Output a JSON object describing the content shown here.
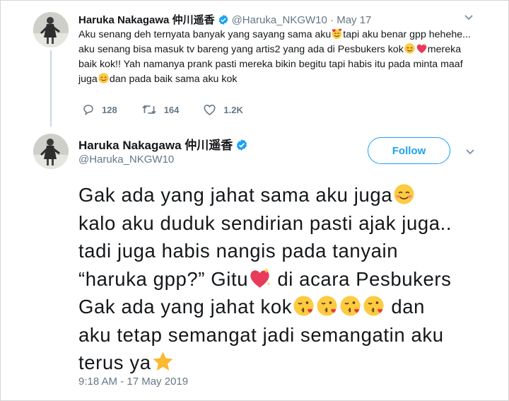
{
  "colors": {
    "accent": "#1da1f2",
    "muted": "#657786",
    "text": "#14171a"
  },
  "reply_tweet": {
    "author_name": "Haruka Nakagawa 仲川遥香",
    "handle": "@Haruka_NKGW10",
    "date_sep": " · ",
    "date": "May 17",
    "text_parts": [
      "Aku senang deh ternyata banyak yang sayang sama aku",
      "tapi aku benar gpp hehehe... aku senang bisa masuk tv bareng yang artis2 yang ada di Pesbukers kok",
      "mereka baik kok!! Yah namanya prank pasti mereka bikin begitu tapi habis itu pada minta maaf juga",
      "dan pada baik sama aku kok"
    ],
    "reply_count": "128",
    "retweet_count": "164",
    "like_count": "1.2K",
    "icons": [
      "smiling-face-with-hearts-icon",
      "relieved-face-icon",
      "sparkling-heart-icon",
      "smiling-blush-face-icon"
    ]
  },
  "main_tweet": {
    "author_name": "Haruka Nakagawa 仲川遥香",
    "handle": "@Haruka_NKGW10",
    "follow_label": "Follow",
    "lines": {
      "l1": "Gak ada yang jahat sama aku juga",
      "l2": "kalo aku duduk sendirian pasti ajak juga..",
      "l3": "tadi juga habis nangis pada tanyain",
      "l4a": "“haruka gpp?” Gitu",
      "l4b": " di acara Pesbukers",
      "l5a": "Gak ada yang jahat kok",
      "l5b": " dan",
      "l6": "aku tetap semangat jadi semangatin aku",
      "l7": "terus ya"
    },
    "timestamp": "9:18 AM - 17 May 2019",
    "icons": [
      "smiling-blush-face-icon",
      "sparkling-heart-icon",
      "kissing-face-icon",
      "star-icon"
    ]
  }
}
